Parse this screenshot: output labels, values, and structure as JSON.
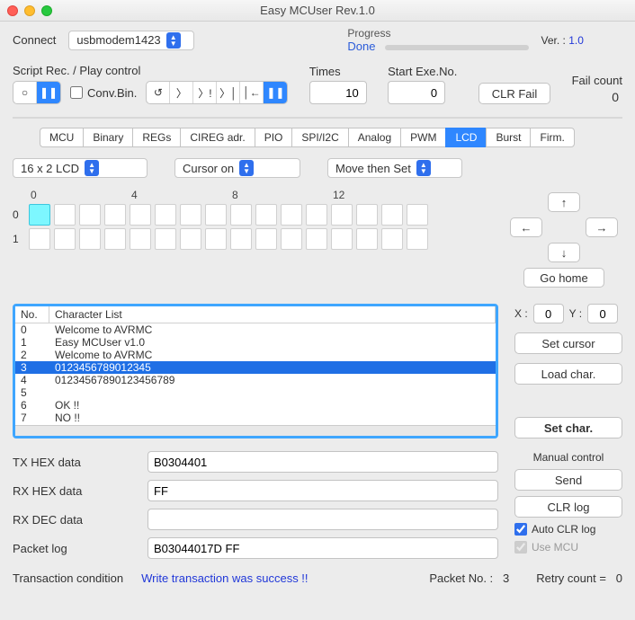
{
  "window": {
    "title": "Easy MCUser Rev.1.0"
  },
  "connect": {
    "label": "Connect",
    "value": "usbmodem1423"
  },
  "progress": {
    "label": "Progress",
    "status": "Done"
  },
  "version": {
    "label": "Ver. : ",
    "value": "1.0"
  },
  "script": {
    "label": "Script Rec. / Play control",
    "rec_icons": [
      "○",
      "❚❚"
    ],
    "conv_label": "Conv.Bin.",
    "play_icons": [
      "↺",
      "〉",
      "〉!",
      "〉│",
      "│←",
      "❚❚"
    ],
    "times_label": "Times",
    "times_value": "10",
    "startno_label": "Start Exe.No.",
    "startno_value": "0",
    "clr_fail": "CLR Fail",
    "fail_label": "Fail count",
    "fail_value": "0"
  },
  "tabs": [
    "MCU",
    "Binary",
    "REGs",
    "CIREG adr.",
    "PIO",
    "SPI/I2C",
    "Analog",
    "PWM",
    "LCD",
    "Burst",
    "Firm."
  ],
  "tab_active": 8,
  "lcd": {
    "size": "16 x 2  LCD",
    "cursor": "Cursor on",
    "mode": "Move then Set",
    "col_marks": [
      "0",
      "4",
      "8",
      "12"
    ],
    "rows": [
      "0",
      "1"
    ],
    "nav": {
      "up": "↑",
      "down": "↓",
      "left": "←",
      "right": "→",
      "home": "Go home"
    },
    "xy": {
      "xlabel": "X :",
      "x": "0",
      "ylabel": "Y :",
      "y": "0"
    },
    "set_cursor": "Set cursor",
    "load_char": "Load char.",
    "set_char": "Set char."
  },
  "list": {
    "cols": [
      "No.",
      "Character List"
    ],
    "rows": [
      {
        "no": "0",
        "txt": "Welcome to AVRMC"
      },
      {
        "no": "1",
        "txt": "Easy MCUser v1.0"
      },
      {
        "no": "2",
        "txt": "Welcome to AVRMC"
      },
      {
        "no": "3",
        "txt": "0123456789012345"
      },
      {
        "no": "4",
        "txt": "01234567890123456789"
      },
      {
        "no": "5",
        "txt": ""
      },
      {
        "no": "6",
        "txt": "OK !!"
      },
      {
        "no": "7",
        "txt": "NO !!"
      }
    ],
    "selected": 3
  },
  "data": {
    "tx_label": "TX HEX data",
    "tx": "B0304401",
    "rx_label": "RX HEX data",
    "rx": "FF",
    "rxdec_label": "RX DEC data",
    "rxdec": "",
    "log_label": "Packet log",
    "log": "B03044017D FF"
  },
  "manual": {
    "label": "Manual control",
    "send": "Send",
    "clr": "CLR log",
    "auto": "Auto CLR log",
    "usemcu": "Use MCU"
  },
  "footer": {
    "trans_label": "Transaction condition",
    "status": "Write transaction was success !!",
    "pkt_label": "Packet No. :",
    "pkt": "3",
    "retry_label": "Retry count  =",
    "retry": "0"
  }
}
